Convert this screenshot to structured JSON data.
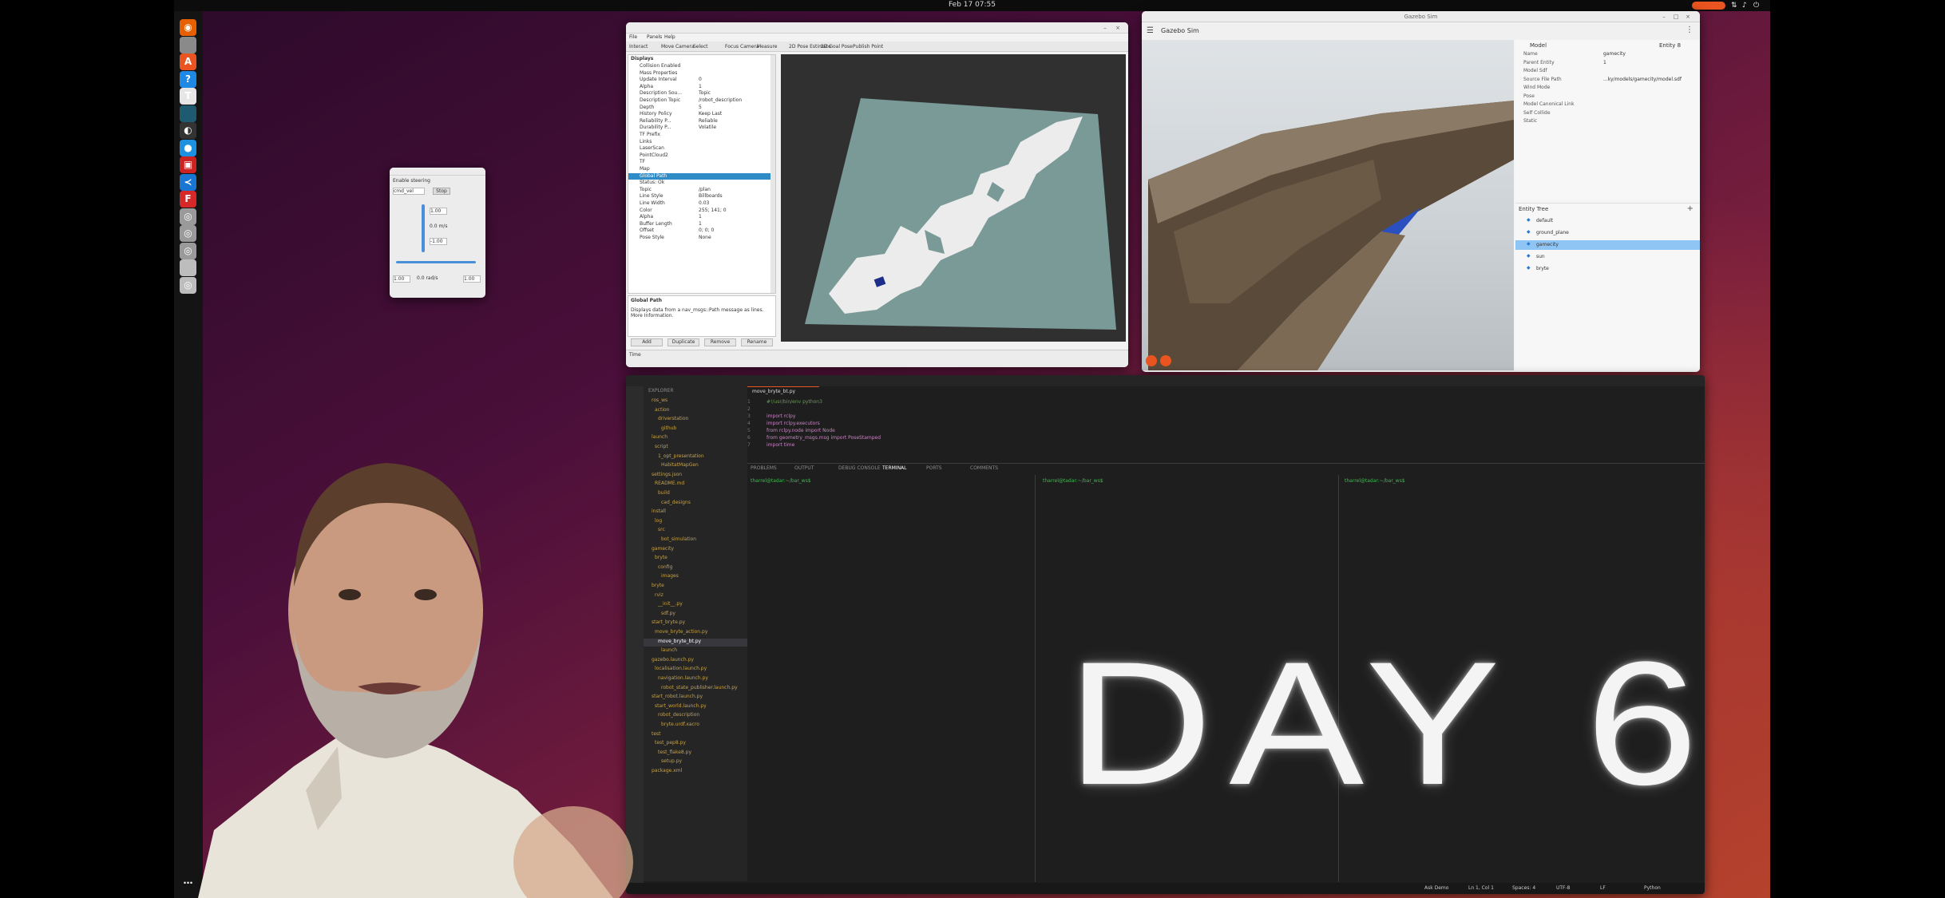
{
  "topbar": {
    "clock": "Feb 17 07:55"
  },
  "dock": {
    "apps": [
      {
        "icon": "firefox-icon",
        "color": "#e66000",
        "glyph": "◉"
      },
      {
        "icon": "files-icon",
        "color": "#8a8a8a",
        "glyph": ""
      },
      {
        "icon": "app-center-icon",
        "color": "#e95420",
        "glyph": "A"
      },
      {
        "icon": "help-icon",
        "color": "#1e88e5",
        "glyph": "?"
      },
      {
        "icon": "text-editor-icon",
        "color": "#e6e6e6",
        "glyph": "T"
      },
      {
        "icon": "terminal-icon",
        "color": "#1e5b70",
        "glyph": ""
      },
      {
        "icon": "obs-icon",
        "color": "#333333",
        "glyph": "◐"
      },
      {
        "icon": "docker-icon",
        "color": "#1d90e0",
        "glyph": "●"
      },
      {
        "icon": "video-app-icon",
        "color": "#cc2222",
        "glyph": "▣"
      },
      {
        "icon": "vscode-icon",
        "color": "#1976d2",
        "glyph": "≺"
      },
      {
        "icon": "foxit-icon",
        "color": "#d62828",
        "glyph": "F"
      },
      {
        "icon": "disc-icon",
        "color": "#9a9a9a",
        "glyph": "◎"
      },
      {
        "icon": "disc-icon-2",
        "color": "#9a9a9a",
        "glyph": "◎"
      },
      {
        "icon": "disc-icon-3",
        "color": "#9a9a9a",
        "glyph": "◎"
      },
      {
        "icon": "trash-icon",
        "color": "#bdbdbd",
        "glyph": ""
      },
      {
        "icon": "disc-icon-4",
        "color": "#bdbdbd",
        "glyph": "◎"
      }
    ],
    "show_apps_icon": "grid-icon"
  },
  "teleop": {
    "labels": [
      "Enable steering",
      "cmd_vel",
      "Stop",
      "1.00",
      "0.0 m/s",
      "-1.00",
      "1.00",
      "0.0 rad/s",
      "1.00"
    ]
  },
  "rviz": {
    "menu": [
      "File",
      "Panels",
      "Help"
    ],
    "tools": [
      "Interact",
      "Move Camera",
      "Select",
      "Focus Camera",
      "Measure",
      "2D Pose Estimate",
      "2D Goal Pose",
      "Publish Point"
    ],
    "displays_title": "Displays",
    "tree": [
      {
        "k": "Collision Enabled",
        "v": "",
        "sel": false
      },
      {
        "k": "Mass Properties",
        "v": "",
        "sel": false
      },
      {
        "k": "Update Interval",
        "v": "0",
        "sel": false
      },
      {
        "k": "Alpha",
        "v": "1",
        "sel": false
      },
      {
        "k": "Description Sou...",
        "v": "Topic",
        "sel": false
      },
      {
        "k": "Description Topic",
        "v": "/robot_description",
        "sel": false
      },
      {
        "k": "Depth",
        "v": "5",
        "sel": false
      },
      {
        "k": "History Policy",
        "v": "Keep Last",
        "sel": false
      },
      {
        "k": "Reliability P...",
        "v": "Reliable",
        "sel": false
      },
      {
        "k": "Durability P...",
        "v": "Volatile",
        "sel": false
      },
      {
        "k": "TF Prefix",
        "v": "",
        "sel": false
      },
      {
        "k": "Links",
        "v": "",
        "sel": false
      },
      {
        "k": "LaserScan",
        "v": "",
        "sel": false
      },
      {
        "k": "PointCloud2",
        "v": "",
        "sel": false
      },
      {
        "k": "TF",
        "v": "",
        "sel": false
      },
      {
        "k": "Map",
        "v": "",
        "sel": false
      },
      {
        "k": "Global Path",
        "v": "",
        "sel": true
      },
      {
        "k": "Status: Ok",
        "v": "",
        "sel": false
      },
      {
        "k": "Topic",
        "v": "/plan",
        "sel": false
      },
      {
        "k": "Line Style",
        "v": "Billboards",
        "sel": false
      },
      {
        "k": "Line Width",
        "v": "0.03",
        "sel": false
      },
      {
        "k": "Color",
        "v": "255; 141; 0",
        "sel": false
      },
      {
        "k": "Alpha",
        "v": "1",
        "sel": false
      },
      {
        "k": "Buffer Length",
        "v": "1",
        "sel": false
      },
      {
        "k": "Offset",
        "v": "0; 0; 0",
        "sel": false
      },
      {
        "k": "Pose Style",
        "v": "None",
        "sel": false
      }
    ],
    "desc_title": "Global Path",
    "desc_text": "Displays data from a nav_msgs::Path message as lines. More Information.",
    "buttons": [
      "Add",
      "Duplicate",
      "Remove",
      "Rename"
    ],
    "time_label": "Time"
  },
  "gazebo": {
    "title": "Gazebo Sim",
    "app_name": "Gazebo Sim",
    "inspector": {
      "header": "Model",
      "entity": "Entity 8",
      "rows": [
        {
          "k": "Name",
          "v": "gamecity"
        },
        {
          "k": "Parent Entity",
          "v": "1"
        },
        {
          "k": "Model Sdf",
          "v": ""
        },
        {
          "k": "Source File Path",
          "v": "...ky/models/gamecity/model.sdf"
        },
        {
          "k": "Wind Mode",
          "v": ""
        },
        {
          "k": "Pose",
          "v": ""
        },
        {
          "k": "Model Canonical Link",
          "v": ""
        },
        {
          "k": "Self Collide",
          "v": ""
        },
        {
          "k": "Static",
          "v": ""
        }
      ]
    },
    "entity_tree_title": "Entity Tree",
    "entities": [
      {
        "name": "default",
        "sel": false
      },
      {
        "name": "ground_plane",
        "sel": false
      },
      {
        "name": "gamecity",
        "sel": true
      },
      {
        "name": "sun",
        "sel": false
      },
      {
        "name": "bryte",
        "sel": false
      }
    ]
  },
  "vscode": {
    "explorer_title": "EXPLORER",
    "files": [
      "ros_ws",
      "action",
      "driverstation",
      "github",
      "launch",
      "script",
      "1_opt_presentation",
      "HabitatMapGen",
      "settings.json",
      "README.md",
      "build",
      "cad_designs",
      "install",
      "log",
      "src",
      "bot_simulation",
      "gamecity",
      "bryte",
      "config",
      "images",
      "bryte",
      "rviz",
      "__init__.py",
      "sdf.py",
      "start_bryte.py",
      "move_bryte_action.py",
      "move_bryte_bt.py",
      "launch",
      "gazebo.launch.py",
      "localisation.launch.py",
      "navigation.launch.py",
      "robot_state_publisher.launch.py",
      "start_robot.launch.py",
      "start_world.launch.py",
      "robot_description",
      "bryte.urdf.xacro",
      "test",
      "test_pep8.py",
      "test_flake8.py",
      "setup.py",
      "package.xml"
    ],
    "tab_label": "move_bryte_bt.py",
    "code": [
      "#!/usr/bin/env python3",
      "",
      "import rclpy",
      "import rclpy.executors",
      "from rclpy.node import Node",
      "from geometry_msgs.msg import PoseStamped",
      "import time"
    ],
    "panel_tabs": [
      "PROBLEMS",
      "OUTPUT",
      "DEBUG CONSOLE",
      "TERMINAL",
      "PORTS",
      "COMMENTS"
    ],
    "prompt": "tharrel@tadar:~/bar_ws$",
    "status": [
      "Ask Demo",
      "Ln 1, Col 1",
      "Spaces: 4",
      "UTF-8",
      "LF",
      "Python"
    ]
  },
  "overlay": {
    "title": "DAY 6"
  },
  "colors": {
    "accent": "#e95420",
    "rviz_bg": "#303030",
    "vscode_bg": "#1e1e1e",
    "selected": "#308cc6"
  }
}
